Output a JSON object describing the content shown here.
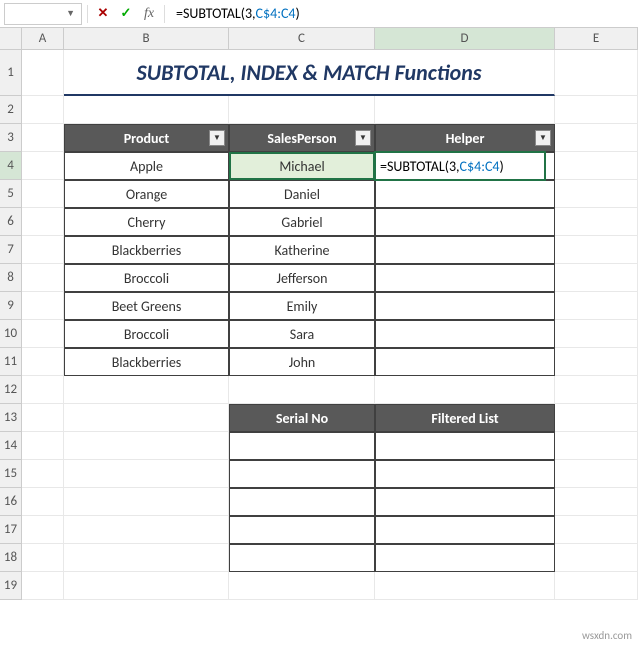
{
  "formula_bar": {
    "name_box": "",
    "cancel": "✕",
    "confirm": "✓",
    "fx": "fx",
    "formula_prefix": "=SUBTOTAL(3,",
    "formula_ref": "C$4:C4",
    "formula_suffix": ")"
  },
  "columns": [
    "A",
    "B",
    "C",
    "D",
    "E"
  ],
  "rows": [
    "1",
    "2",
    "3",
    "4",
    "5",
    "6",
    "7",
    "8",
    "9",
    "10",
    "11",
    "12",
    "13",
    "14",
    "15",
    "16",
    "17",
    "18",
    "19"
  ],
  "title": "SUBTOTAL, INDEX & MATCH Functions",
  "table1": {
    "headers": {
      "product": "Product",
      "salesperson": "SalesPerson",
      "helper": "Helper"
    },
    "rows": [
      {
        "product": "Apple",
        "salesperson": "Michael"
      },
      {
        "product": "Orange",
        "salesperson": "Daniel"
      },
      {
        "product": "Cherry",
        "salesperson": "Gabriel"
      },
      {
        "product": "Blackberries",
        "salesperson": "Katherine"
      },
      {
        "product": "Broccoli",
        "salesperson": "Jefferson"
      },
      {
        "product": "Beet Greens",
        "salesperson": "Emily"
      },
      {
        "product": "Broccoli",
        "salesperson": "Sara"
      },
      {
        "product": "Blackberries",
        "salesperson": "John"
      }
    ]
  },
  "active_cell": {
    "formula_prefix": "=SUBTOTAL(3,",
    "formula_ref": "C$4:C4",
    "formula_suffix": ")"
  },
  "table2": {
    "headers": {
      "serial": "Serial No",
      "filtered": "Filtered List"
    }
  },
  "watermark": "wsxdn.com"
}
